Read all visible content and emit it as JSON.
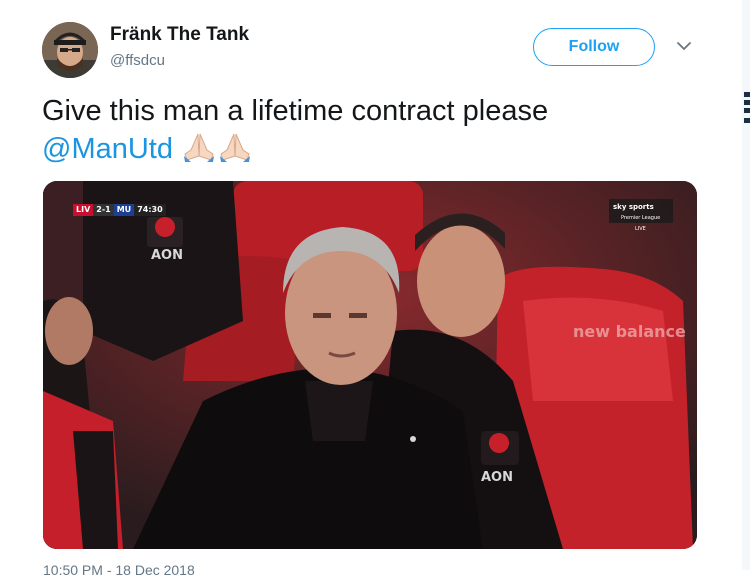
{
  "header": {
    "display_name": "Fränk The Tank",
    "handle": "@ffsdcu",
    "follow_label": "Follow"
  },
  "tweet": {
    "text": "Give this man a lifetime contract please",
    "mention": "@ManUtd",
    "emoji": [
      "folded-hands-icon",
      "folded-hands-icon"
    ],
    "timestamp": "10:50 PM - 18 Dec 2018"
  },
  "media": {
    "score_bug": {
      "home": "LIV",
      "score": "2-1",
      "away": "MU",
      "clock": "74:30"
    },
    "broadcaster": "sky sports",
    "broadcaster_sub": "Premier League",
    "broadcaster_live": "LIVE",
    "shirt_sponsor": "AON",
    "seat_brand": "new balance"
  },
  "colors": {
    "accent": "#1da1f2",
    "mention": "#1b95e0",
    "text": "#14171a",
    "secondary": "#657786"
  }
}
